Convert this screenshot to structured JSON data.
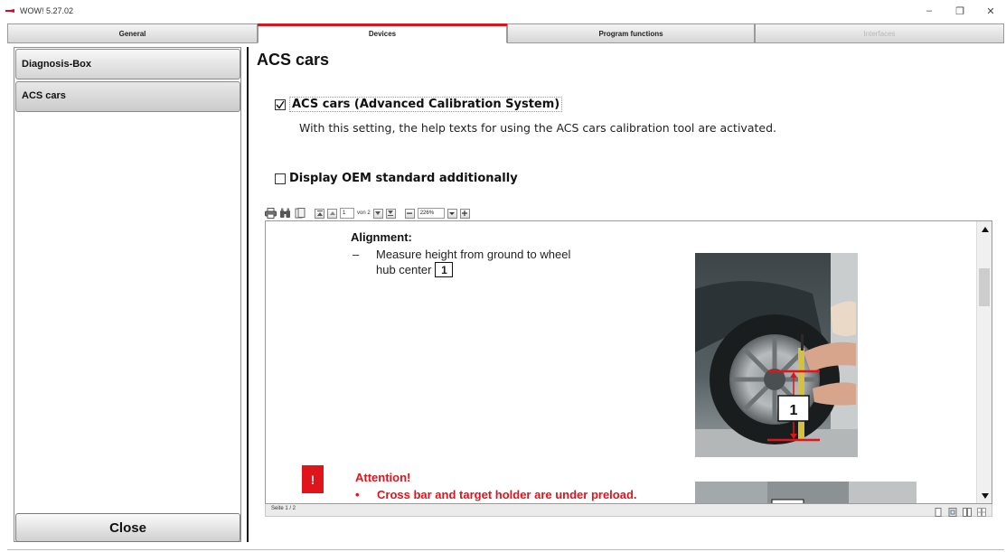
{
  "window": {
    "title": "WOW! 5.27.02",
    "controls": {
      "minimize": "–",
      "restore": "❐",
      "close": "✕"
    }
  },
  "tabs": [
    {
      "label": "General",
      "state": "normal"
    },
    {
      "label": "Devices",
      "state": "active"
    },
    {
      "label": "Program functions",
      "state": "normal"
    },
    {
      "label": "Interfaces",
      "state": "disabled"
    }
  ],
  "sidebar": {
    "items": [
      {
        "label": "Diagnosis-Box"
      },
      {
        "label": "ACS cars"
      }
    ],
    "close_label": "Close"
  },
  "content": {
    "title": "ACS cars",
    "option1": {
      "label": "ACS cars (Advanced Calibration System)",
      "checked": true
    },
    "description": "With this setting, the help texts for using the ACS cars calibration tool are activated.",
    "option2": {
      "label": "Display OEM standard additionally",
      "checked": false
    }
  },
  "pdf": {
    "toolbar": {
      "page_value": "1",
      "page_of": "von 2",
      "zoom_value": "226%"
    },
    "page": {
      "heading": "Alignment:",
      "bullet_dash": "–",
      "bullet_line1": "Measure height from ground to wheel",
      "bullet_line2": "hub center",
      "callout_number": "1",
      "photo_callout": "1",
      "warning_symbol": "!",
      "attention_title": "Attention!",
      "attention_bullet": "•",
      "attention_item": "Cross bar and target holder are under preload."
    },
    "status": "Seite 1 / 2"
  },
  "colors": {
    "accent_red": "#d7181f",
    "warning_red": "#e0141b"
  }
}
